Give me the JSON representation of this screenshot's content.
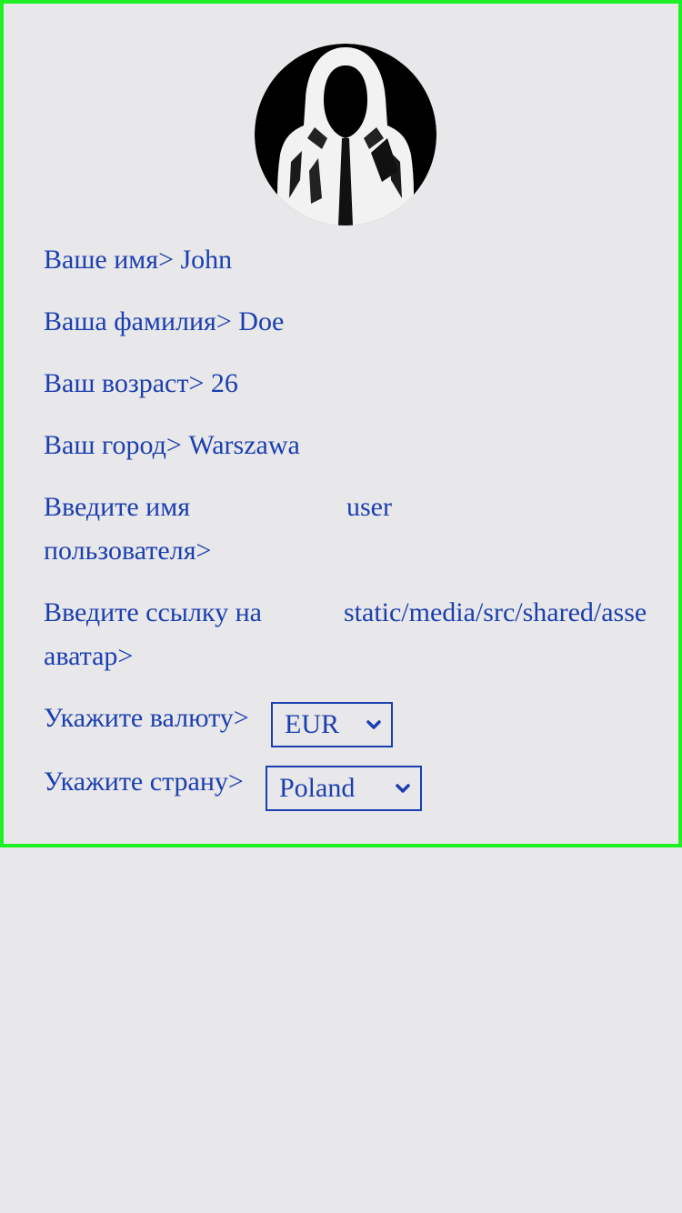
{
  "profile": {
    "avatar_icon": "hooded-figure-avatar",
    "first_name": {
      "label": "Ваше имя>",
      "value": "John"
    },
    "last_name": {
      "label": "Ваша фамилия>",
      "value": "Doe"
    },
    "age": {
      "label": "Ваш возраст>",
      "value": "26"
    },
    "city": {
      "label": "Ваш город>",
      "value": "Warszawa"
    },
    "username": {
      "label": "Введите имя пользователя>",
      "value": "user"
    },
    "avatar_link": {
      "label": "Введите ссылку на аватар>",
      "value": "static/media/src/shared/assets"
    },
    "currency": {
      "label": "Укажите валюту>",
      "selected": "EUR"
    },
    "country": {
      "label": "Укажите страну>",
      "selected": "Poland"
    }
  },
  "colors": {
    "text": "#1b3fb0",
    "border": "#1ff023",
    "background": "#e8e7e9"
  }
}
